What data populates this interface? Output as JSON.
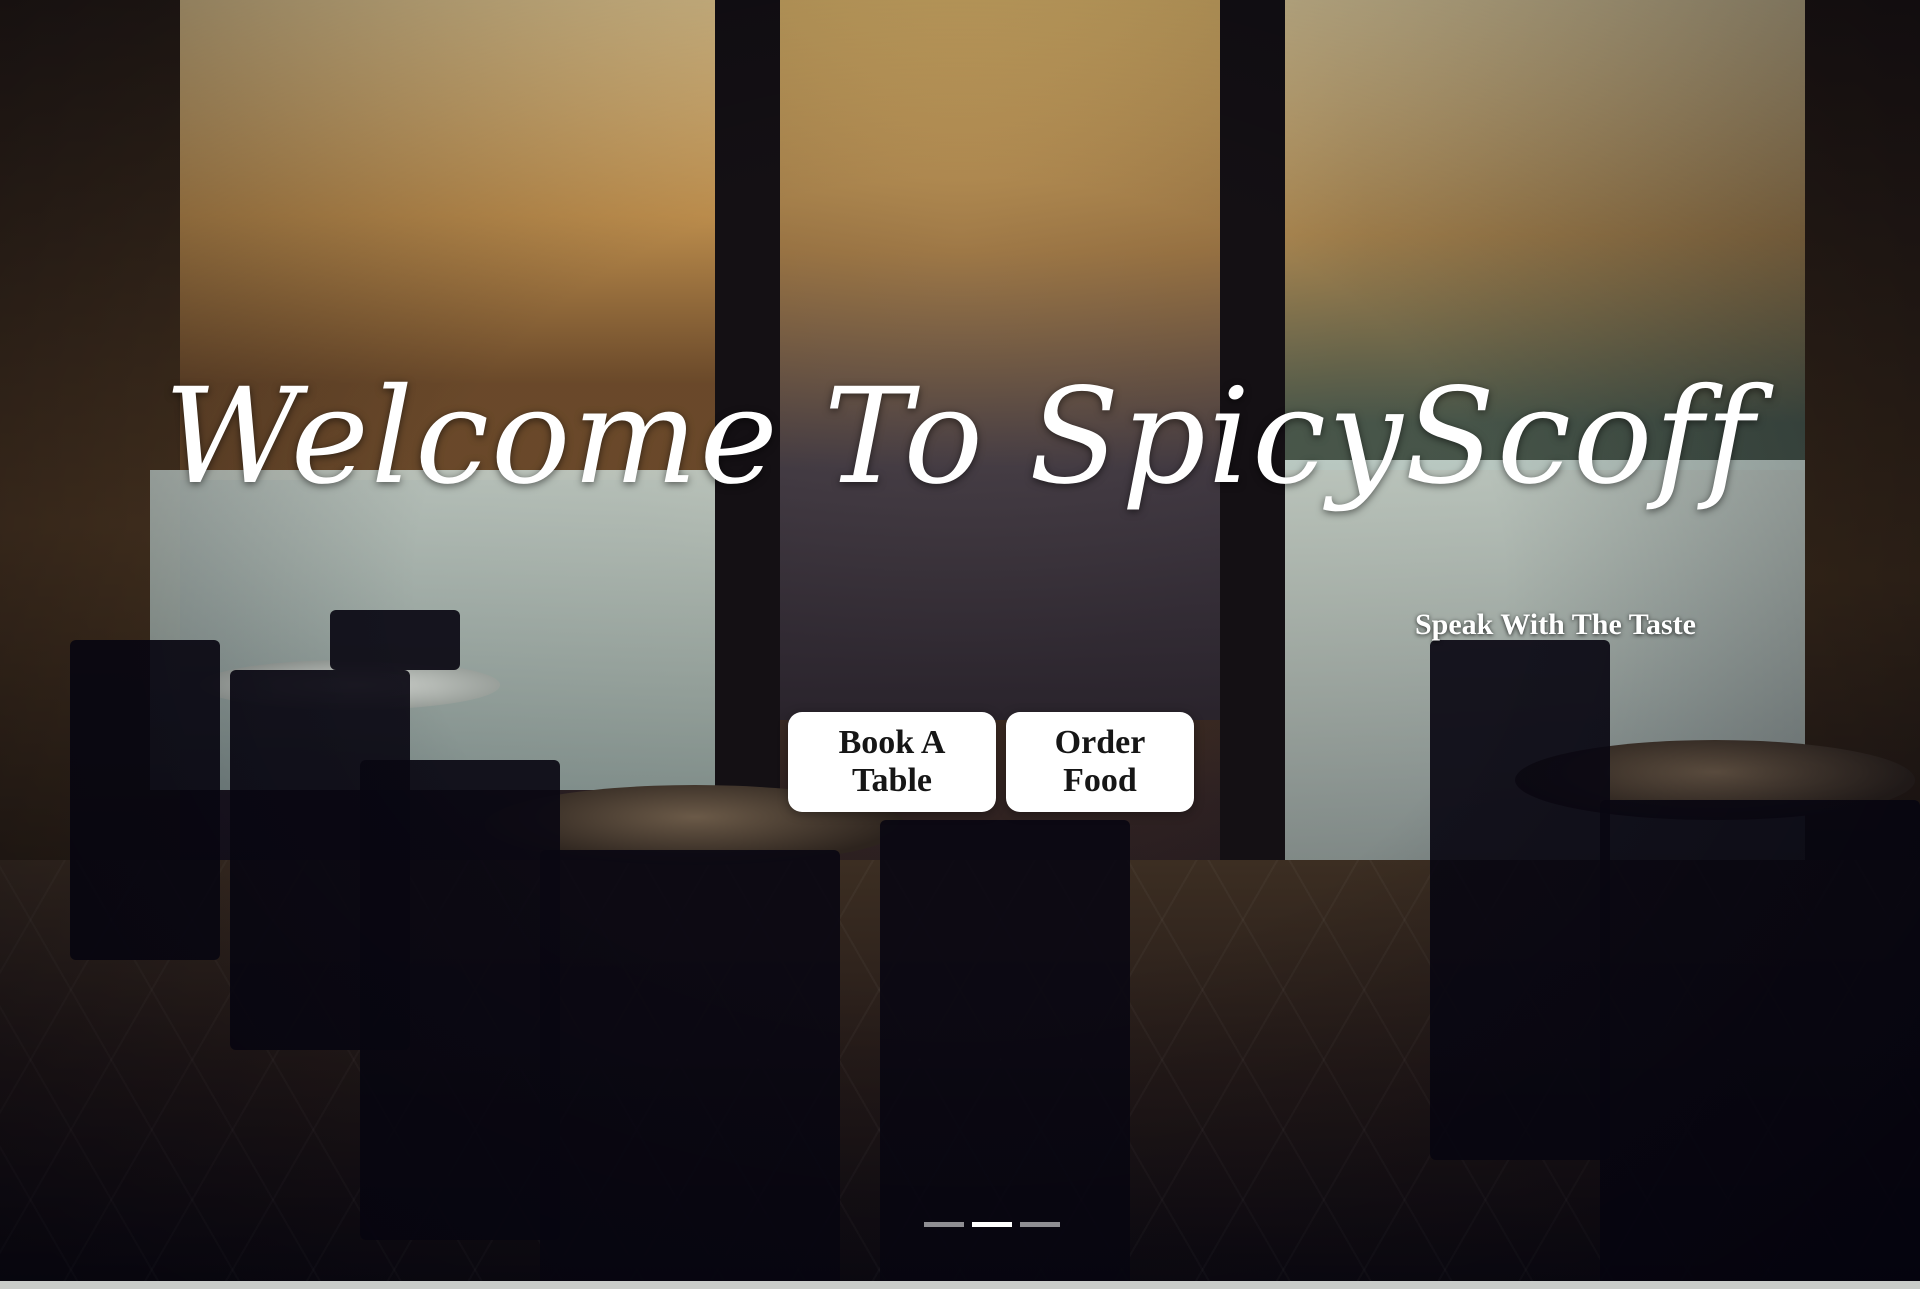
{
  "hero": {
    "headline": "Welcome To SpicyScoff",
    "tagline": "Speak With The Taste",
    "buttons": {
      "book_label": "Book A Table",
      "order_label": "Order Food"
    },
    "carousel": {
      "slide_count": 3,
      "active_index": 1
    }
  },
  "colors": {
    "text": "#ffffff",
    "button_bg": "#ffffff",
    "button_text": "#161616",
    "background_dark": "#0c0a12"
  }
}
